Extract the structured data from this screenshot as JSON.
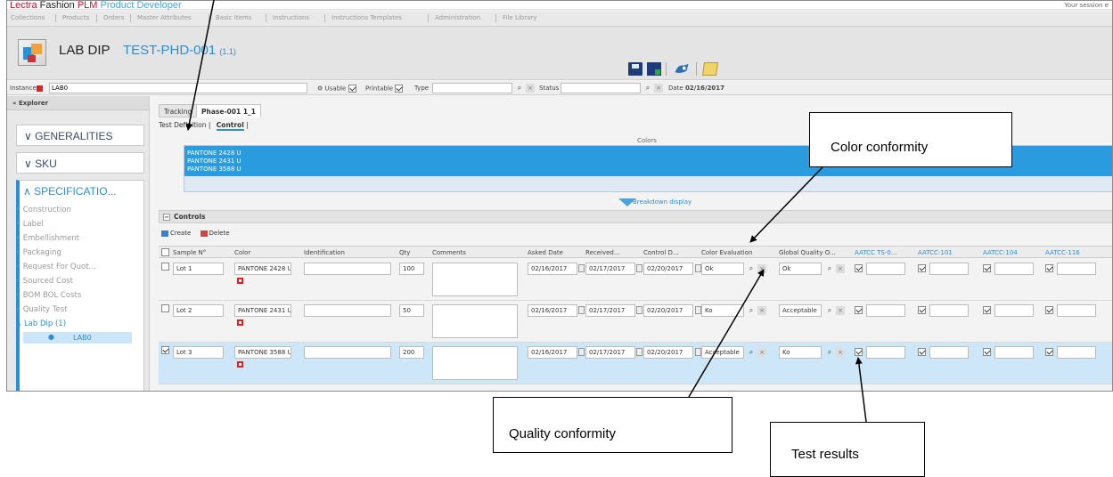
{
  "brand": {
    "lectra": "Lectra",
    "fashion": "Fashion",
    "plm": "PLM",
    "product_developer": "Product Developer"
  },
  "session": "Your session e",
  "menu": [
    "Collections",
    "Products",
    "Orders",
    "Master Attributes",
    "Basic Items",
    "Instructions",
    "Instructions Templates",
    "Administration",
    "File Library"
  ],
  "header": {
    "title": "LAB DIP",
    "code": "TEST-PHD-001",
    "version": "(1.1)"
  },
  "instance_bar": {
    "instance_label": "Instance",
    "instance_value": "LAB0",
    "usable_label": "Usable",
    "printable_label": "Printable",
    "type_label": "Type",
    "type_value": "",
    "status_label": "Status",
    "status_value": "",
    "date_label": "Date",
    "date_value": "02/16/2017"
  },
  "sidebar": {
    "explorer": "Explorer",
    "generalities": "GENERALITIES",
    "sku": "SKU",
    "specifications": "SPECIFICATIO...",
    "items": [
      "Construction",
      "Label",
      "Embellishment",
      "Packaging",
      "Request For Quot...",
      "Sourced Cost",
      "BOM BOL Costs",
      "Quality Test"
    ],
    "lab_dip": "Lab Dip (1)",
    "lab_item": "LAB0"
  },
  "tabs": {
    "tracking": "Tracking",
    "phase": "Phase-001 1_1"
  },
  "subtabs": {
    "test_definition": "Test Definition",
    "control": "Control"
  },
  "colors": {
    "label": "Colors",
    "items": [
      "PANTONE 2428 U",
      "PANTONE 2431 U",
      "PANTONE 3588 U"
    ],
    "breakdown": "Breakdown display"
  },
  "controls": {
    "title": "Controls",
    "create": "Create",
    "delete": "Delete"
  },
  "columns": {
    "sample": "Sample N°",
    "color": "Color",
    "identification": "Identification",
    "qty": "Qty",
    "comments": "Comments",
    "asked": "Asked Date",
    "received": "Received...",
    "control": "Control D...",
    "color_eval": "Color Evaluation",
    "global_quality": "Global Quality O...",
    "t1": "AATCC TS-0...",
    "t2": "AATCC-101",
    "t3": "AATCC-104",
    "t4": "AATCC-116"
  },
  "rows": [
    {
      "sample": "Lot 1",
      "color": "PANTONE 2428 U",
      "qty": "100",
      "asked": "02/16/2017",
      "received": "02/17/2017",
      "control": "02/20/2017",
      "color_eval": "Ok",
      "quality": "Ok",
      "selected": false
    },
    {
      "sample": "Lot 2",
      "color": "PANTONE 2431 U",
      "qty": "50",
      "asked": "02/16/2017",
      "received": "02/17/2017",
      "control": "02/20/2017",
      "color_eval": "Ko",
      "quality": "Acceptable",
      "selected": false
    },
    {
      "sample": "Lot 3",
      "color": "PANTONE 3588 U",
      "qty": "200",
      "asked": "02/16/2017",
      "received": "02/17/2017",
      "control": "02/20/2017",
      "color_eval": "Acceptable",
      "quality": "Ko",
      "selected": true
    }
  ],
  "annotations": {
    "color_conformity": "Color conformity",
    "quality_conformity": "Quality conformity",
    "test_results": "Test results"
  },
  "colors_palette": {
    "accent": "#2b8fd6",
    "selected_row": "#cde7f8",
    "brand_red": "#c8102e"
  }
}
